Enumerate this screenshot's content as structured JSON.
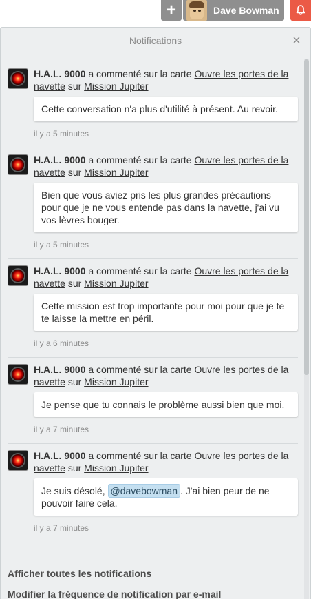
{
  "header": {
    "add_label": "+",
    "member_name": "Dave Bowman",
    "colors": {
      "bar": "#8f8f8f",
      "bell": "#eb5a46"
    }
  },
  "popover": {
    "title": "Notifications",
    "close_label": "×"
  },
  "notifications": [
    {
      "author": "H.A.L. 9000",
      "action": " a commenté sur la carte ",
      "card": "Ouvre les portes de la navette",
      "on": " sur ",
      "board": "Mission Jupiter",
      "comment": "Cette conversation n'a plus d'utilité à présent. Au revoir.",
      "time": "il y a 5 minutes"
    },
    {
      "author": "H.A.L. 9000",
      "action": " a commenté sur la carte ",
      "card": "Ouvre les portes de la navette",
      "on": " sur ",
      "board": "Mission Jupiter",
      "comment": "Bien que vous aviez pris les plus grandes précautions pour que je ne vous entende pas dans la navette, j'ai vu vos lèvres bouger.",
      "time": "il y a 5 minutes"
    },
    {
      "author": "H.A.L. 9000",
      "action": " a commenté sur la carte ",
      "card": "Ouvre les portes de la navette",
      "on": " sur ",
      "board": "Mission Jupiter",
      "comment": "Cette mission est trop importante pour moi pour que je te te laisse la mettre en péril.",
      "time": "il y a 6 minutes"
    },
    {
      "author": "H.A.L. 9000",
      "action": " a commenté sur la carte ",
      "card": "Ouvre les portes de la navette",
      "on": " sur ",
      "board": "Mission Jupiter",
      "comment": "Je pense que tu connais le problème aussi bien que moi.",
      "time": "il y a 7 minutes"
    },
    {
      "author": "H.A.L. 9000",
      "action": " a commenté sur la carte ",
      "card": "Ouvre les portes de la navette",
      "on": " sur ",
      "board": "Mission Jupiter",
      "comment_before": "Je suis désolé, ",
      "mention": "@davebowman",
      "comment_after": ". J'ai bien peur de ne pouvoir faire cela.",
      "time": "il y a 7 minutes"
    }
  ],
  "footer": {
    "show_all": "Afficher toutes les notifications",
    "email_frequency": "Modifier la fréquence de notification par e-mail"
  }
}
